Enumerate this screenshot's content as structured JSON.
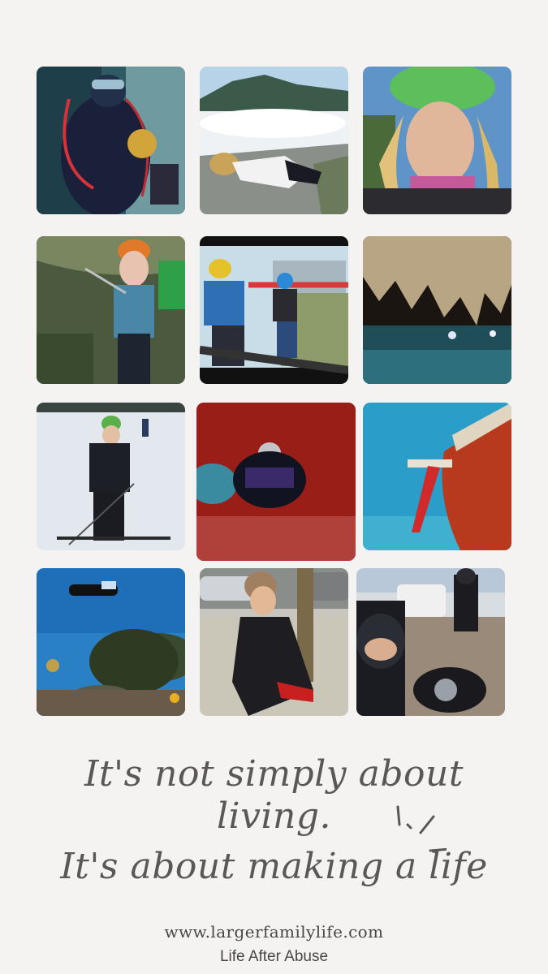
{
  "quote": {
    "line1": "It's not simply about",
    "line2": "living.",
    "line3": "It's about making a life"
  },
  "footer": {
    "website": "www.largerfamilylife.com",
    "tagline": "Life After Abuse"
  },
  "colors": {
    "background": "#f5f3f2",
    "text": "#5b5756"
  }
}
